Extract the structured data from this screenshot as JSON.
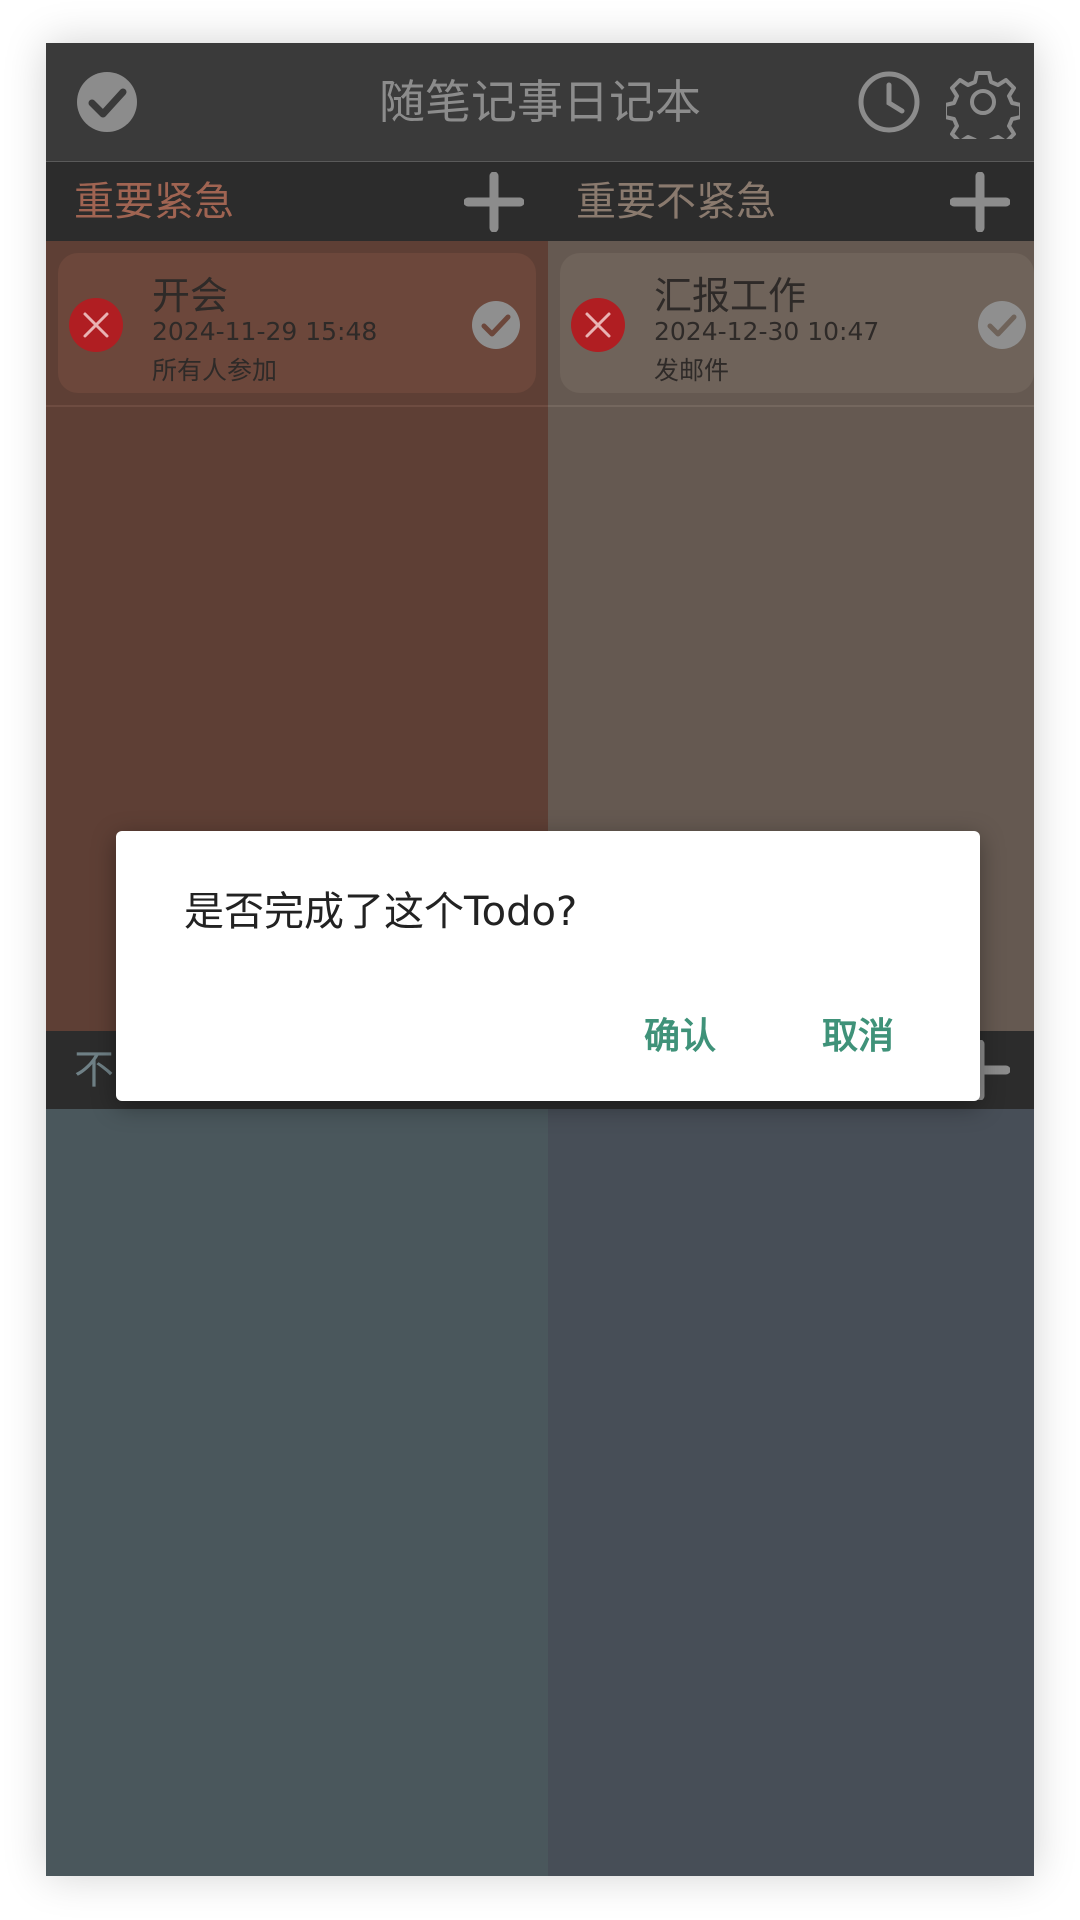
{
  "app": {
    "title": "随笔记事日记本",
    "icons": [
      "check-circle-icon",
      "clock-icon",
      "gear-icon"
    ]
  },
  "quadrants": [
    {
      "title": "重要紧急",
      "title_color": "#a06452",
      "body_color": "#5e3f35",
      "card_color": "#6c473b",
      "todos": [
        {
          "title": "开会",
          "date": "2024-11-29 15:48",
          "note": "所有人参加"
        }
      ]
    },
    {
      "title": "重要不紧急",
      "title_color": "#8a7a6e",
      "body_color": "#655951",
      "card_color": "#6f635a",
      "todos": [
        {
          "title": "汇报工作",
          "date": "2024-12-30 10:47",
          "note": "发邮件"
        }
      ]
    },
    {
      "title": "不",
      "title_color": "#6f8086",
      "body_color": "#4a575c",
      "todos": []
    },
    {
      "title": "",
      "title_color": "#6f7880",
      "body_color": "#474e57",
      "todos": []
    }
  ],
  "dialog": {
    "message": "是否完成了这个Todo?",
    "confirm_label": "确认",
    "cancel_label": "取消",
    "button_color": "#3f9279"
  }
}
